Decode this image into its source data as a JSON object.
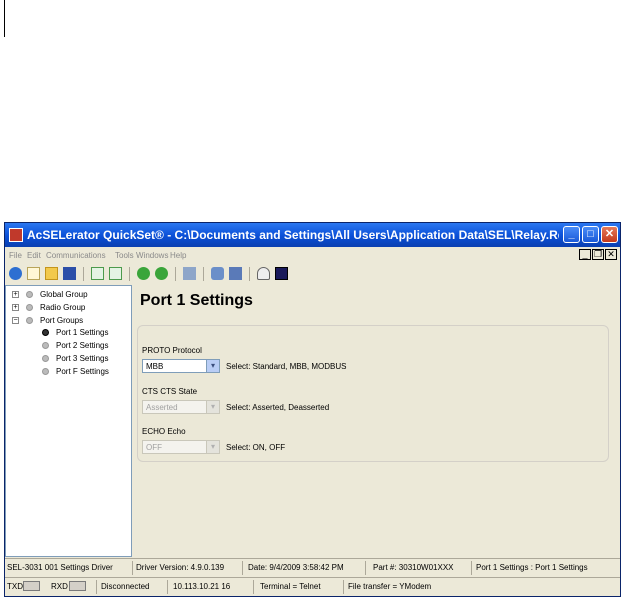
{
  "window": {
    "title": "AcSELerator QuickSet® - C:\\Documents and Settings\\All Users\\Application Data\\SEL\\Relay.Rdb - [Settings E...",
    "minimize_label": "_",
    "maximize_label": "□",
    "close_label": "✕"
  },
  "menu": [
    "File",
    "Edit",
    "Communications",
    "Tools",
    "Windows",
    "Help"
  ],
  "mdi_controls": {
    "minimize": "_",
    "restore": "❐",
    "close": "✕"
  },
  "toolbar": {
    "icons": [
      "connect-icon",
      "new-icon",
      "open-folder-icon",
      "save-icon",
      "read-icon",
      "send-icon",
      "go-green-icon",
      "go-green-alt-icon",
      "network-icon",
      "settings-icon",
      "download-icon",
      "meter-icon",
      "terminal-icon"
    ]
  },
  "tree": {
    "global_group": "Global Group",
    "radio_group": "Radio Group",
    "port_groups": "Port Groups",
    "port_items": [
      "Port 1 Settings",
      "Port 2 Settings",
      "Port 3 Settings",
      "Port F Settings"
    ],
    "expand_symbol": "+",
    "collapse_symbol": "−"
  },
  "main": {
    "title": "Port 1 Settings",
    "settings": [
      {
        "label": "PROTO Protocol",
        "value": "MBB",
        "hint": "Select: Standard, MBB, MODBUS",
        "enabled": true
      },
      {
        "label": "CTS CTS State",
        "value": "Asserted",
        "hint": "Select: Asserted, Deasserted",
        "enabled": false
      },
      {
        "label": "ECHO Echo",
        "value": "OFF",
        "hint": "Select: ON, OFF",
        "enabled": false
      }
    ],
    "dropdown_arrow": "▾"
  },
  "status1": {
    "driver": "SEL-3031 001 Settings Driver",
    "driver_version": "Driver Version: 4.9.0.139",
    "date": "Date: 9/4/2009 3:58:42 PM",
    "part": "Part #: 30310W01XXX",
    "location": "Port 1 Settings : Port 1 Settings"
  },
  "status2": {
    "txd": "TXD",
    "rxd": "RXD",
    "connection": "Disconnected",
    "address": "10.113.10.21  16",
    "terminal": "Terminal = Telnet",
    "file_transfer": "File transfer = YModem"
  }
}
